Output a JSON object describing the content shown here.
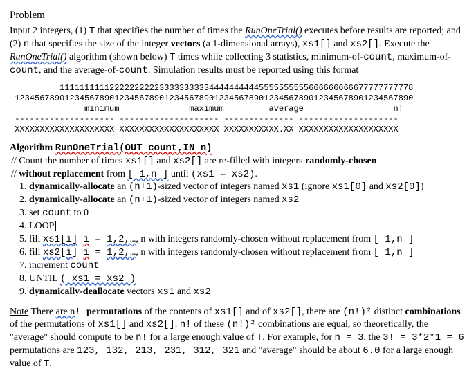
{
  "heading": "Problem",
  "p1_a": "Input 2 integers, (1) ",
  "p1_T": "T",
  "p1_b": " that specifies the number of times the ",
  "p1_run1": "RunOneTrial()",
  "p1_c": " executes before results are reported; and (2) ",
  "p1_n": "n",
  "p1_d": " that specifies the size of the integer ",
  "p1_vectors": "vectors",
  "p1_e": " (a 1-dimensional arrays), ",
  "p1_xs1": "xs1[]",
  "p1_f": " and ",
  "p1_xs2": "xs2[]",
  "p1_g": ". Execute the ",
  "p1_run2": "RunOneTrial()",
  "p1_h": " algorithm (shown below) ",
  "p1_T2": "T",
  "p1_i": " times while collecting 3 statistics, minimum-of-",
  "p1_count1": "count",
  "p1_j": ", maximum-of-",
  "p1_count2": "count",
  "p1_k": ", and the average-of-",
  "p1_count3": "count",
  "p1_l": ". Simulation results must be reported using this format",
  "table_line1": "          11111111112222222222333333333344444444445555555555666666666677777777778",
  "table_line2": " 12345678901234567890123456789012345678901234567890123456789012345678901234567890",
  "table_line3": "               minimum              maximum         average                  n!",
  "table_line4": " -------------------- -------------------- -------------- --------------------",
  "table_line5": " XXXXXXXXXXXXXXXXXXXX XXXXXXXXXXXXXXXXXXXX XXXXXXXXXXX.XX XXXXXXXXXXXXXXXXXXXX",
  "algo_title_a": "Algorithm ",
  "algo_title_b": "RunOneTrial(OUT count,IN n)",
  "c1_a": "// Count the number of times ",
  "c1_xs1": "xs1[]",
  "c1_b": " and ",
  "c1_xs2": "xs2[]",
  "c1_c": " are re-filled with integers ",
  "c1_rand": "randomly-chosen",
  "c2_a": "//    ",
  "c2_wr": "without replacement",
  "c2_b": " from ",
  "c2_range": "[ 1,n ]",
  "c2_c": " until ",
  "c2_eq": "(xs1 = xs2)",
  "c2_d": ".",
  "s1_a": "1. ",
  "s1_dyn": "dynamically-allocate",
  "s1_b": " an ",
  "s1_np1": "(n+1)",
  "s1_c": "-sized vector of integers named ",
  "s1_xs1": "xs1",
  "s1_d": " (ignore ",
  "s1_xs10": "xs1[0]",
  "s1_e": " and ",
  "s1_xs20": "xs2[0]",
  "s1_f": ")",
  "s2_a": "2. ",
  "s2_dyn": "dynamically-allocate",
  "s2_b": " an ",
  "s2_np1": "(n+1)",
  "s2_c": "-sized vector of integers named ",
  "s2_xs2": "xs2",
  "s3_a": "3. set ",
  "s3_count": "count",
  "s3_b": " to 0",
  "s4": "4. LOOP",
  "s5_a": "5.    fill ",
  "s5_xs": "xs1[i]",
  "s5_sp": " ",
  "s5_i": "i",
  "s5_eq": " = ",
  "s5_range": "1,2,…",
  "s5_b": ", n with integers randomly-chosen without replacement from ",
  "s5_brn": "[ 1,n ]",
  "s6_a": "6.    fill ",
  "s6_xs": "xs2[i]",
  "s6_sp": " ",
  "s6_i": "i",
  "s6_eq": " = ",
  "s6_range": "1,2,…",
  "s6_b": ", n with integers randomly-chosen without replacement from ",
  "s6_brn": "[ 1,n ]",
  "s7_a": "7.    increment ",
  "s7_count": "count",
  "s8_a": "8. UNTIL ",
  "s8_eq": "( xs1 = xs2 )",
  "s9_a": "9. ",
  "s9_dyn": "dynamically-deallocate",
  "s9_b": " vectors ",
  "s9_xs1": "xs1",
  "s9_c": " and ",
  "s9_xs2": "xs2",
  "note_a": "Note",
  "note_b": " There ",
  "note_are": "are n",
  "note_c": "! ",
  "note_perm": "permutations",
  "note_d": " of the contents of ",
  "note_xs1": "xs1[]",
  "note_e": " and of ",
  "note_xs2": "xs2[]",
  "note_f": ", there are ",
  "note_nf2": "(n!)²",
  "note_g": " distinct ",
  "note_comb": "combinations",
  "note_h": " of the permutations of ",
  "note_xs1b": "xs1[]",
  "note_i": " and ",
  "note_xs2b": "xs2[]",
  "note_j": ". ",
  "note_nf": "n!",
  "note_k": " of these ",
  "note_nf2b": "(n!)²",
  "note_l": " combinations are equal, so theoretically, the \"average\" should compute to be ",
  "note_nfc": "n!",
  "note_m": " for a large enough value of ",
  "note_T": "T",
  "note_n": ". For example, for ",
  "note_neq": "n = 3",
  "note_o": ", the ",
  "note_calc": "3! = 3*2*1 = 6",
  "note_p": " permutations are ",
  "note_perms": "123, 132, 213, 231, 312, 321",
  "note_q": " and \"average\" should be about ",
  "note_six": "6.0",
  "note_r": " for a large enough value of ",
  "note_T2": "T",
  "note_s": "."
}
